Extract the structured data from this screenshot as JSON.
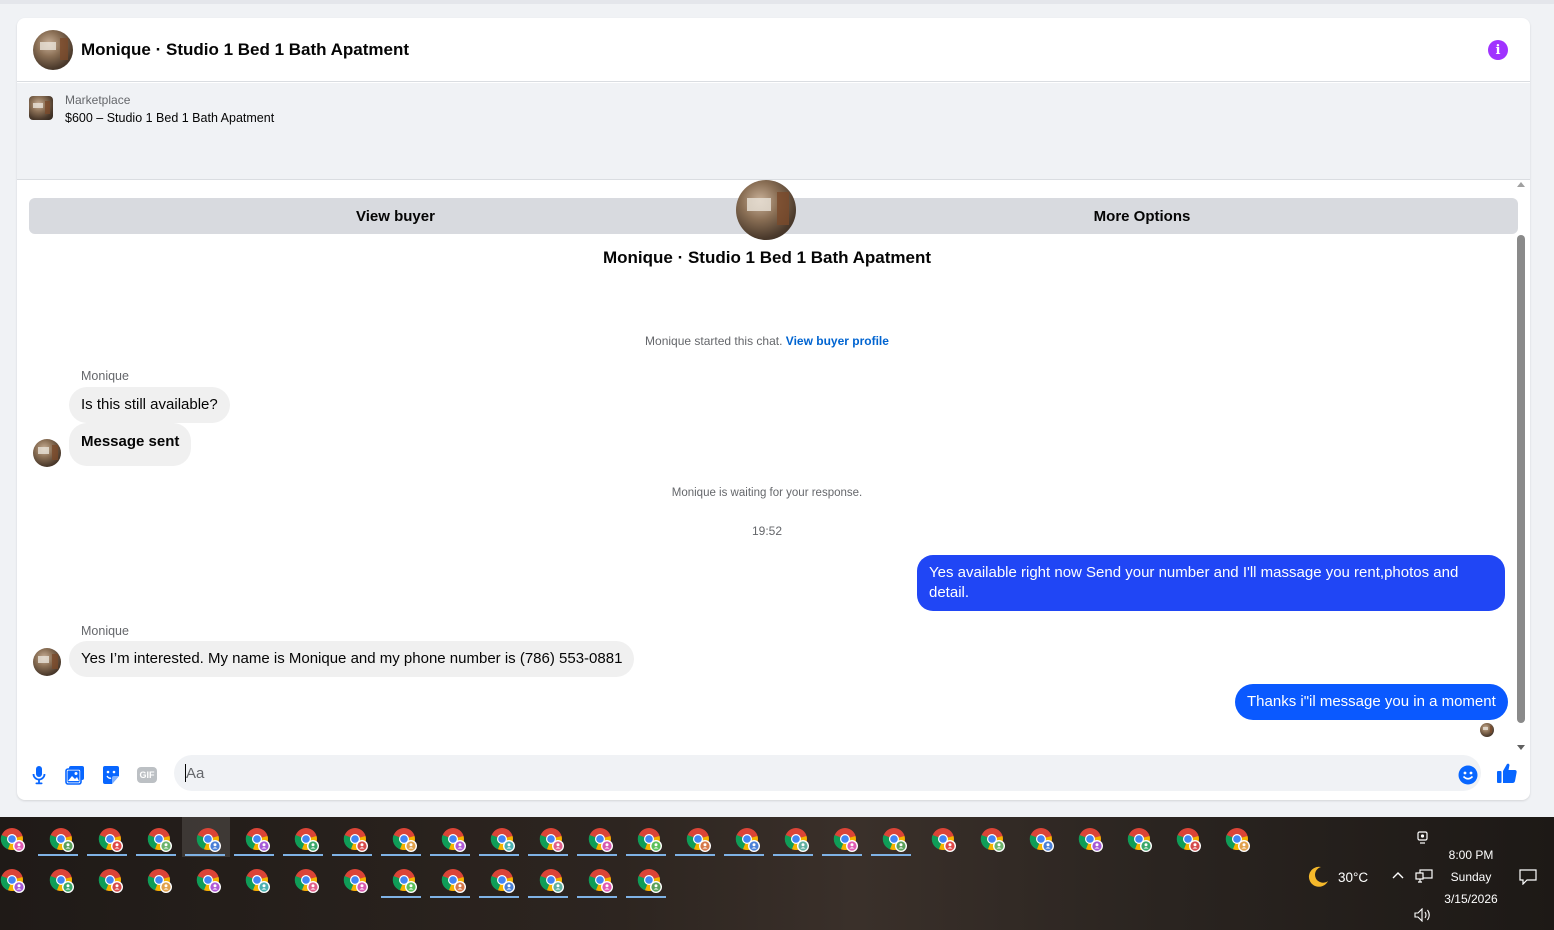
{
  "header": {
    "title": "Monique · Studio 1 Bed 1 Bath Apatment",
    "info_icon": "info-icon",
    "accent": "#a033ff"
  },
  "marketplace": {
    "label": "Marketplace",
    "listing": "$600 – Studio 1 Bed 1 Bath Apatment",
    "view_buyer": "View buyer",
    "more_options": "More Options"
  },
  "chat": {
    "title": "Monique · Studio 1 Bed 1 Bath Apatment",
    "started_text": "Monique started this chat.",
    "view_profile": "View buyer profile",
    "sender1": "Monique",
    "msg1": "Is this still available?",
    "msg2": "Message sent",
    "waiting": "Monique is waiting for your response.",
    "time": "19:52",
    "out1": "Yes available right now Send your number and I'll massage you rent,photos and detail.",
    "sender2": "Monique",
    "msg3": "Yes I’m interested. My name is Monique and my phone number is (786) 553-0881",
    "out2": "Thanks i\"il message you in a moment",
    "outgoing_color": "#0a59ff"
  },
  "composer": {
    "placeholder": "Aa",
    "tools": [
      "microphone-icon",
      "photo-icon",
      "sticker-icon",
      "gif-icon"
    ],
    "gif_label": "GIF"
  },
  "taskbar": {
    "temperature": "30°C",
    "time": "8:00 PM",
    "day": "Sunday",
    "date": "3/15/2026"
  }
}
